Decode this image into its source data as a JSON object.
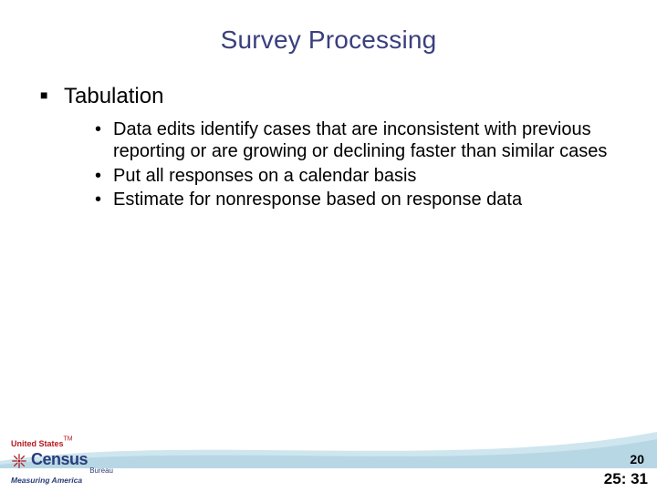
{
  "title": "Survey Processing",
  "section": {
    "heading": "Tabulation",
    "bullets": [
      "Data edits identify cases that are inconsistent with previous reporting or are growing or declining faster than similar cases",
      "Put all responses on a calendar basis",
      "Estimate for nonresponse based on response data"
    ]
  },
  "logo": {
    "top_line": "United States",
    "tm": "TM",
    "word": "Census",
    "bureau": "Bureau",
    "tagline": "Measuring America"
  },
  "page_number": "20",
  "timestamp": "25: 31",
  "colors": {
    "title": "#3a3f7d",
    "swoosh_light": "#cfe6ef",
    "swoosh_dark": "#abd0df"
  }
}
